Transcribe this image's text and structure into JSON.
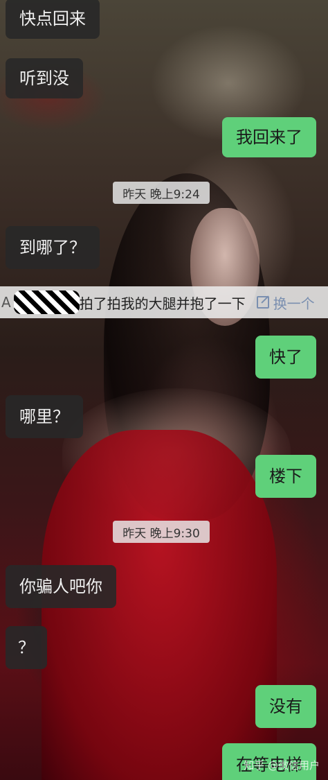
{
  "chat": {
    "messages": [
      {
        "side": "left",
        "text": "快点回来"
      },
      {
        "side": "left",
        "text": "听到没"
      },
      {
        "side": "right",
        "text": "我回来了"
      },
      {
        "side": "time",
        "text": "昨天 晚上9:24"
      },
      {
        "side": "left",
        "text": "到哪了？"
      },
      {
        "side": "left",
        "text": "哪里？"
      },
      {
        "side": "right",
        "text": "快了"
      },
      {
        "side": "right",
        "text": "楼下"
      },
      {
        "side": "time",
        "text": "昨天 晚上9:30"
      },
      {
        "side": "left",
        "text": "你骗人吧你"
      },
      {
        "side": "left",
        "text": "？"
      },
      {
        "side": "right",
        "text": "没有"
      },
      {
        "side": "right",
        "text": "在等电梯"
      }
    ],
    "pat_notice": {
      "prefix": "A",
      "action": "拍了拍我的大腿并抱了一下",
      "swap_label": "换一个"
    }
  },
  "watermark": "知乎 @微信用户",
  "colors": {
    "sent_bubble": "#5fd07a",
    "received_bubble": "#282828",
    "time_pill": "#e6e6e6"
  }
}
